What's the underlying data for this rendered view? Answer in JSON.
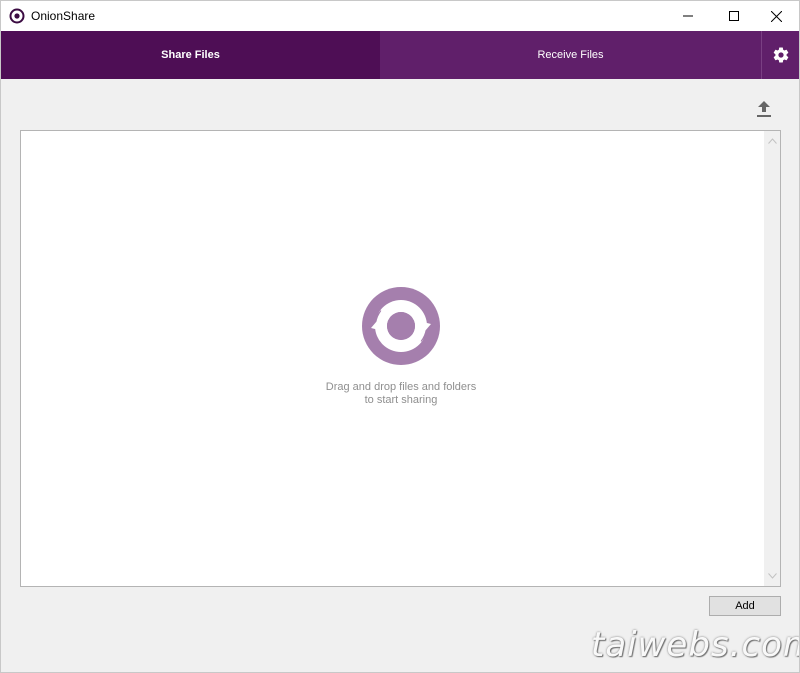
{
  "window": {
    "title": "OnionShare"
  },
  "tabs": [
    {
      "label": "Share Files",
      "active": true
    },
    {
      "label": "Receive Files",
      "active": false
    }
  ],
  "icons": {
    "app": "onionshare-logo-icon",
    "settings": "gear-icon",
    "upload": "upload-icon",
    "drop": "sync-arrows-icon"
  },
  "dropzone": {
    "line1": "Drag and drop files and folders",
    "line2": "to start sharing"
  },
  "buttons": {
    "add_label": "Add"
  },
  "watermark": "taiwebs.com",
  "colors": {
    "tab_active": "#4e0e55",
    "tab_inactive": "#601f6a",
    "drop_icon": "#a57fad",
    "hint_text": "#8f8f8f"
  }
}
